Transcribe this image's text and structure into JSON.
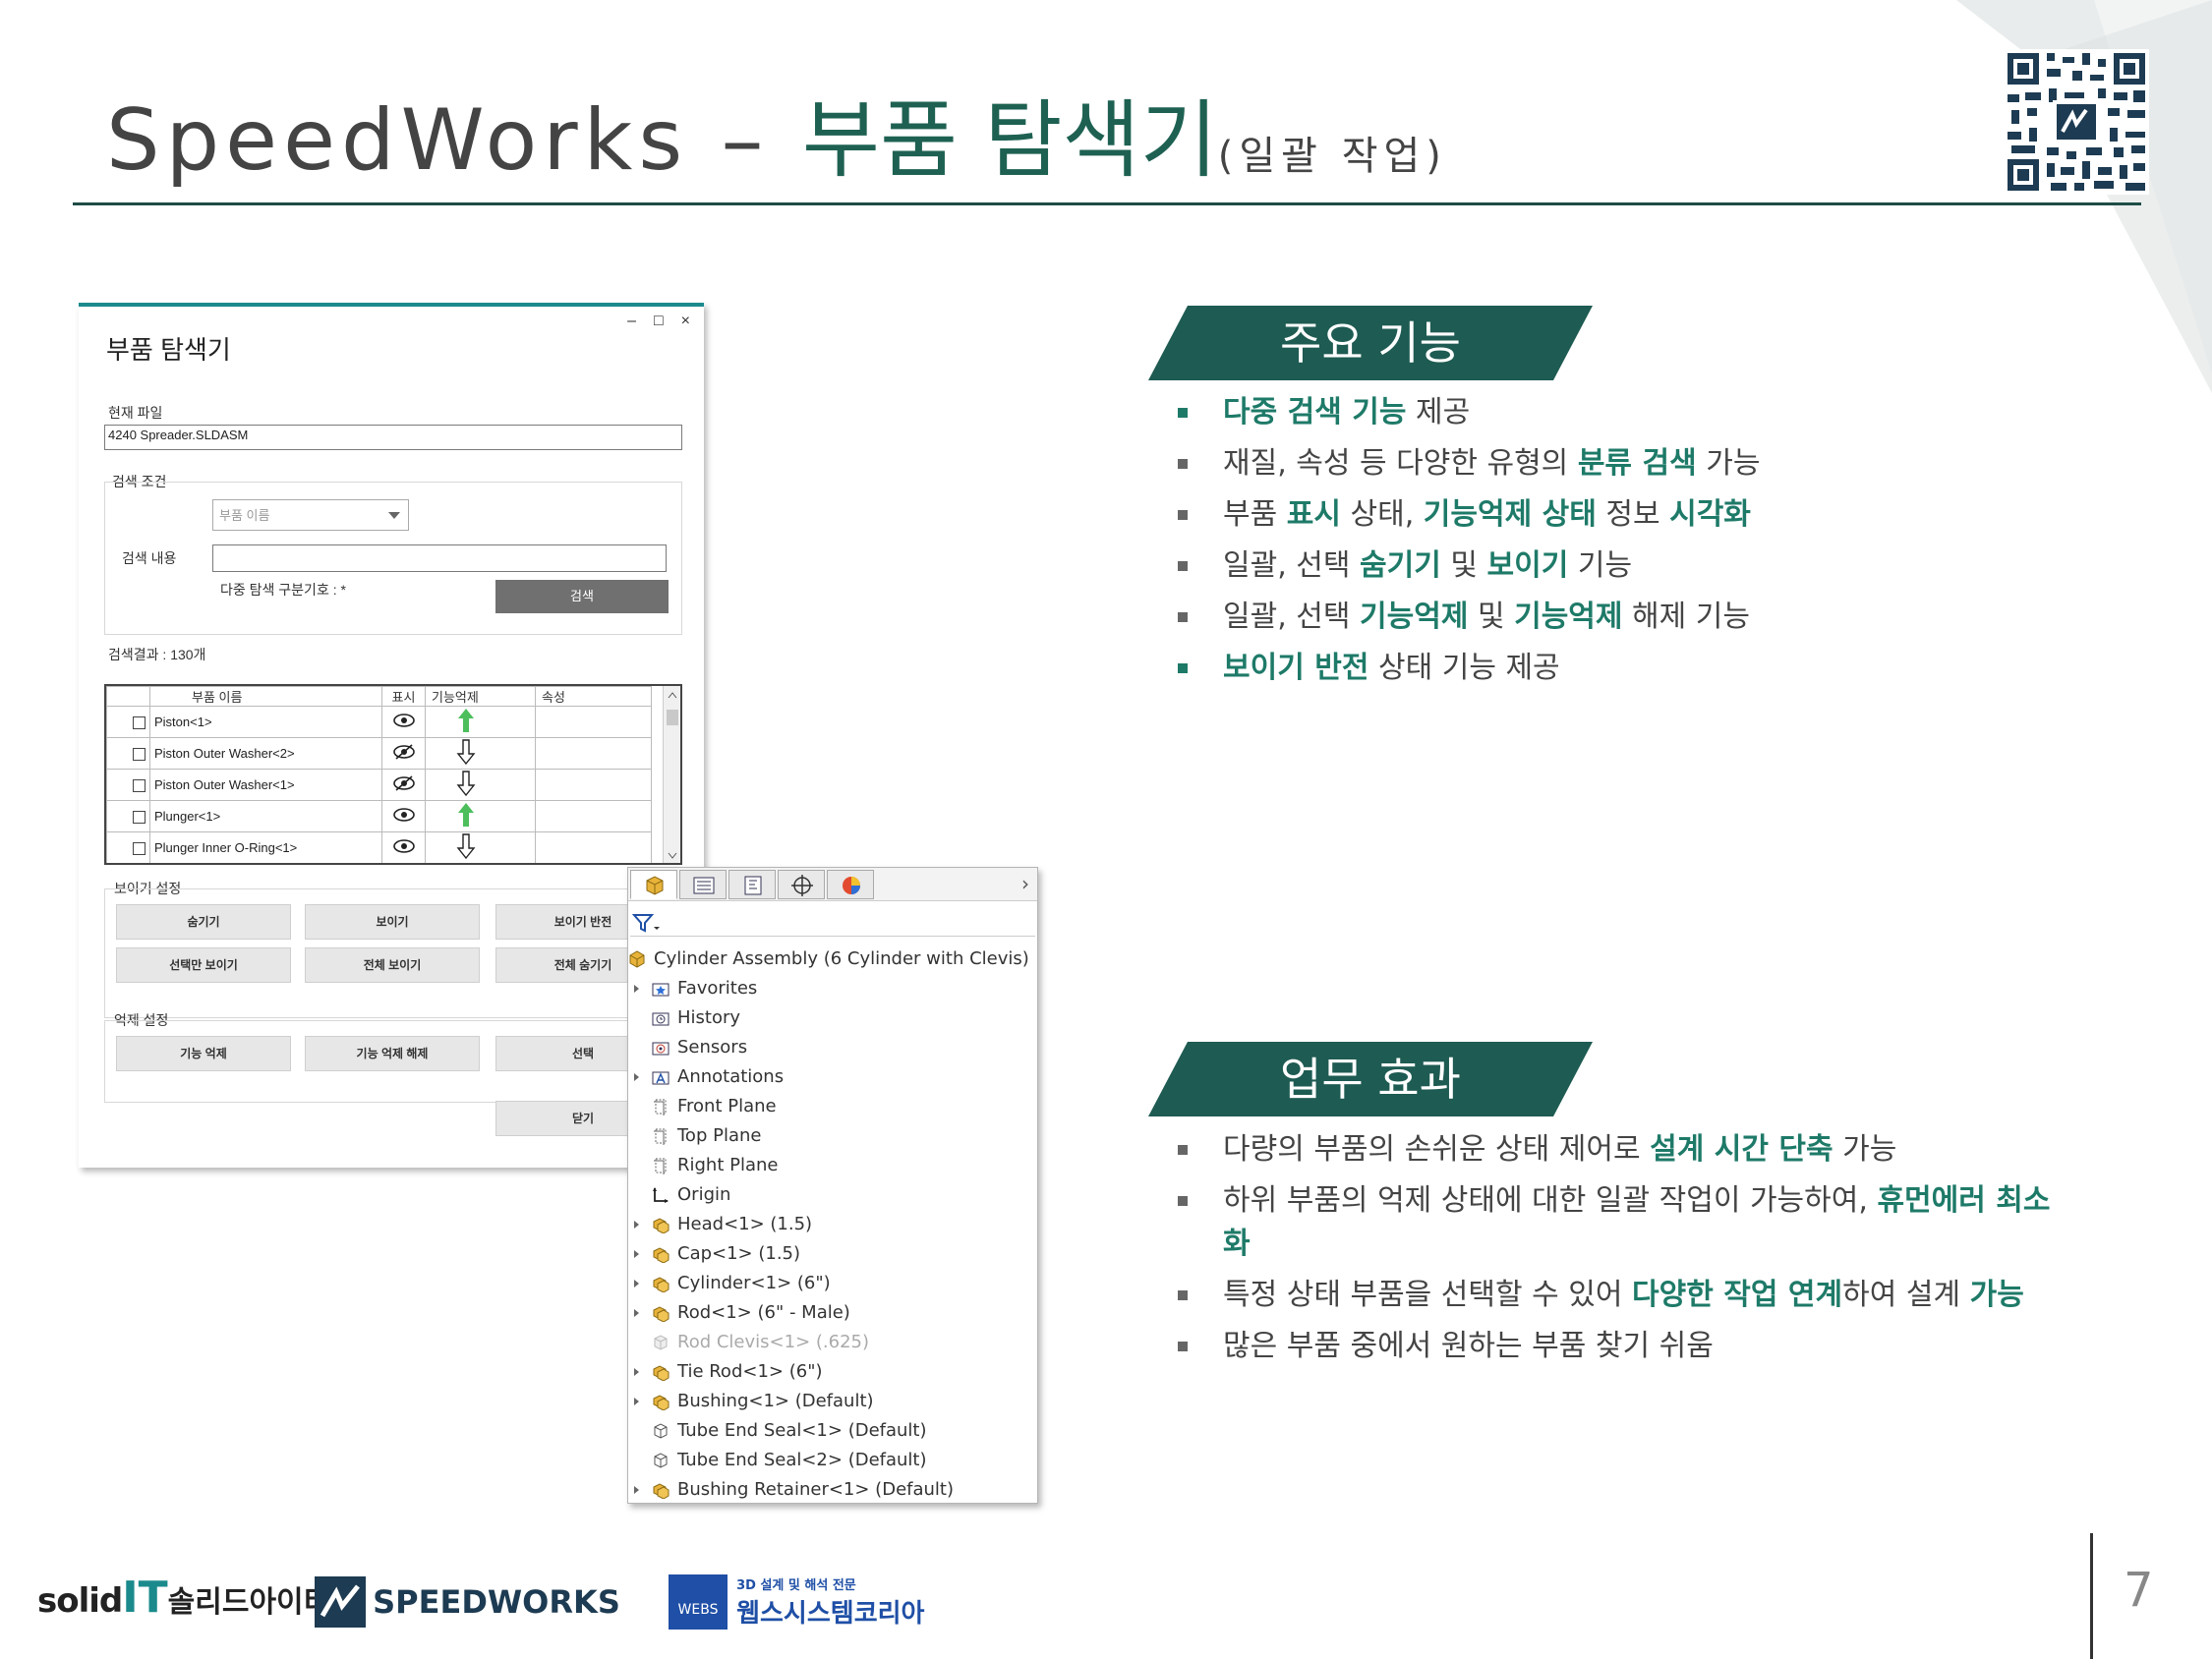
{
  "slide": {
    "title_en": "SpeedWorks – ",
    "title_ko": "부품 탐색기",
    "title_sub": "(일괄 작업)",
    "page_number": "7"
  },
  "explorer": {
    "title": "부품 탐색기",
    "current_file_label": "현재 파일",
    "current_file_value": "4240 Spreader.SLDASM",
    "search_cond_label": "검색 조건",
    "search_type_placeholder": "부품 이름",
    "search_content_label": "검색 내용",
    "search_content_value": "",
    "multi_search_hint": "다중 탐색 구분기호 : *",
    "search_button": "검색",
    "result_label": "검색결과 : 130개",
    "columns": [
      "부품 이름",
      "표시",
      "기능억제",
      "속성"
    ],
    "rows": [
      {
        "name": "Piston<1>",
        "visible": true,
        "suppressed": false
      },
      {
        "name": "Piston Outer Washer<2>",
        "visible": false,
        "suppressed": true
      },
      {
        "name": "Piston Outer Washer<1>",
        "visible": false,
        "suppressed": true
      },
      {
        "name": "Plunger<1>",
        "visible": true,
        "suppressed": false
      },
      {
        "name": "Plunger Inner O-Ring<1>",
        "visible": true,
        "suppressed": true
      }
    ],
    "visibility_section": "보이기 설정",
    "btn_hide": "숨기기",
    "btn_show": "보이기",
    "btn_invert": "보이기 반전",
    "btn_show_selected": "선택만 보이기",
    "btn_show_all": "전체 보이기",
    "btn_hide_all": "전체 숨기기",
    "suppress_section": "억제 설정",
    "btn_suppress": "기능 억제",
    "btn_unsuppress": "기능 억제 해제",
    "btn_select": "선택",
    "btn_close": "닫기",
    "win_min": "–",
    "win_max": "□",
    "win_close": "×"
  },
  "tree": {
    "expand_glyph": "›",
    "root": "Cylinder Assembly  (6 Cylinder with Clevis)",
    "items": [
      {
        "label": "Favorites",
        "expand": true,
        "icon": "favorites-folder-icon"
      },
      {
        "label": "History",
        "expand": false,
        "icon": "history-icon"
      },
      {
        "label": "Sensors",
        "expand": false,
        "icon": "sensors-icon"
      },
      {
        "label": "Annotations",
        "expand": true,
        "icon": "annotations-icon"
      },
      {
        "label": "Front Plane",
        "expand": false,
        "icon": "plane-icon"
      },
      {
        "label": "Top Plane",
        "expand": false,
        "icon": "plane-icon"
      },
      {
        "label": "Right Plane",
        "expand": false,
        "icon": "plane-icon"
      },
      {
        "label": "Origin",
        "expand": false,
        "icon": "origin-icon"
      },
      {
        "label": "Head<1> (1.5)",
        "expand": true,
        "icon": "assembly-icon"
      },
      {
        "label": "Cap<1> (1.5)",
        "expand": true,
        "icon": "assembly-icon"
      },
      {
        "label": "Cylinder<1> (6\")",
        "expand": true,
        "icon": "assembly-icon"
      },
      {
        "label": "Rod<1> (6\" - Male)",
        "expand": true,
        "icon": "assembly-icon"
      },
      {
        "label": "Rod Clevis<1> (.625)",
        "expand": false,
        "icon": "part-suppressed-icon",
        "dim": true
      },
      {
        "label": "Tie Rod<1> (6\")",
        "expand": true,
        "icon": "assembly-icon"
      },
      {
        "label": "Bushing<1> (Default)",
        "expand": true,
        "icon": "assembly-icon"
      },
      {
        "label": "Tube End Seal<1> (Default)",
        "expand": false,
        "icon": "part-icon"
      },
      {
        "label": "Tube End Seal<2> (Default)",
        "expand": false,
        "icon": "part-icon"
      },
      {
        "label": "Bushing Retainer<1> (Default)",
        "expand": true,
        "icon": "assembly-icon"
      }
    ]
  },
  "features": {
    "heading": "주요 기능",
    "items": [
      {
        "parts": [
          {
            "t": "다중 검색 기능",
            "hl": true
          },
          {
            "t": " 제공"
          }
        ],
        "teal": true
      },
      {
        "parts": [
          {
            "t": "재질, 속성 등 다양한 유형의 "
          },
          {
            "t": "분류 검색",
            "hl": true
          },
          {
            "t": " 가능"
          }
        ]
      },
      {
        "parts": [
          {
            "t": "부품 "
          },
          {
            "t": "표시",
            "hl": true
          },
          {
            "t": " 상태, "
          },
          {
            "t": "기능억제 상태",
            "hl": true
          },
          {
            "t": " 정보 "
          },
          {
            "t": "시각화",
            "hl": true
          }
        ]
      },
      {
        "parts": [
          {
            "t": "일괄, 선택 "
          },
          {
            "t": "숨기기",
            "hl": true
          },
          {
            "t": " 및 "
          },
          {
            "t": "보이기",
            "hl": true
          },
          {
            "t": " 기능"
          }
        ]
      },
      {
        "parts": [
          {
            "t": "일괄, 선택 "
          },
          {
            "t": "기능억제",
            "hl": true
          },
          {
            "t": " 및 "
          },
          {
            "t": "기능억제",
            "hl": true
          },
          {
            "t": " 해제 기능"
          }
        ]
      },
      {
        "parts": [
          {
            "t": "보이기 반전",
            "hl": true
          },
          {
            "t": " 상태 기능 제공"
          }
        ],
        "teal": true
      }
    ]
  },
  "effects": {
    "heading": "업무 효과",
    "items": [
      {
        "parts": [
          {
            "t": "다량의 부품의 손쉬운 상태 제어로 "
          },
          {
            "t": "설계 시간 단축",
            "hl": true
          },
          {
            "t": " 가능"
          }
        ]
      },
      {
        "parts": [
          {
            "t": "하위 부품의 억제 상태에 대한 일괄 작업이 가능하여, "
          },
          {
            "t": "휴먼에러 최소화",
            "hl": true
          }
        ],
        "two": true
      },
      {
        "parts": [
          {
            "t": "특정 상태 부품을 선택할 수 있어 "
          },
          {
            "t": "다양한 작업 연계",
            "hl": true
          },
          {
            "t": "하여 설계 "
          },
          {
            "t": "가능",
            "hl": true
          }
        ]
      },
      {
        "parts": [
          {
            "t": "많은 부품 중에서 원하는 부품 찾기 쉬움"
          }
        ]
      }
    ]
  },
  "footer": {
    "solidit_en": "solid",
    "solidit_bar": "IT",
    "solidit_ko": "솔리드아이티",
    "speedworks": "SPEEDWORKS",
    "webs_badge": "WEBS",
    "webs_tagline": "3D 설계 및 해석 전문",
    "webs_name": "웹스시스템코리아"
  },
  "colors": {
    "accent": "#1e6152",
    "highlight": "#1e7a68",
    "window_accent": "#1b8a8c"
  }
}
